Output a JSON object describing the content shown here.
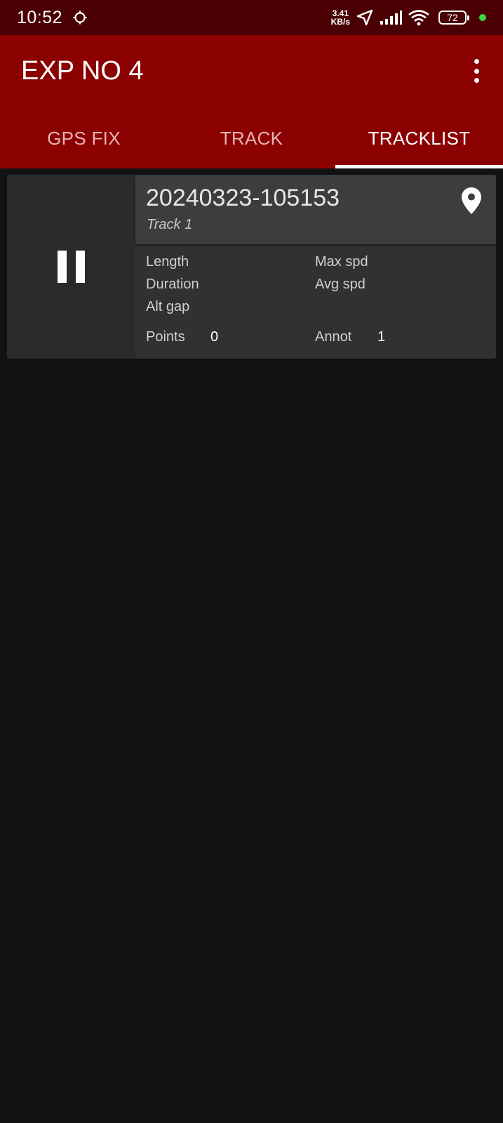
{
  "status_bar": {
    "time": "10:52",
    "net_speed_value": "3.41",
    "net_speed_unit": "KB/s",
    "battery_level": "72",
    "icons": [
      "sync-icon",
      "location-arrow-icon",
      "signal-icon",
      "wifi-icon",
      "battery-icon"
    ],
    "privacy_dot_color": "#37d24a"
  },
  "app_bar": {
    "title": "EXP NO 4",
    "background_color": "#8b0000"
  },
  "tabs": [
    {
      "label": "GPS FIX",
      "active": false
    },
    {
      "label": "TRACK",
      "active": false
    },
    {
      "label": "TRACKLIST",
      "active": true
    }
  ],
  "track": {
    "name": "20240323-105153",
    "subtitle": "Track 1",
    "state_icon": "pause-icon",
    "stats": {
      "length_label": "Length",
      "duration_label": "Duration",
      "alt_gap_label": "Alt gap",
      "max_spd_label": "Max spd",
      "avg_spd_label": "Avg spd",
      "points_label": "Points",
      "points_value": "0",
      "annot_label": "Annot",
      "annot_value": "1"
    }
  }
}
